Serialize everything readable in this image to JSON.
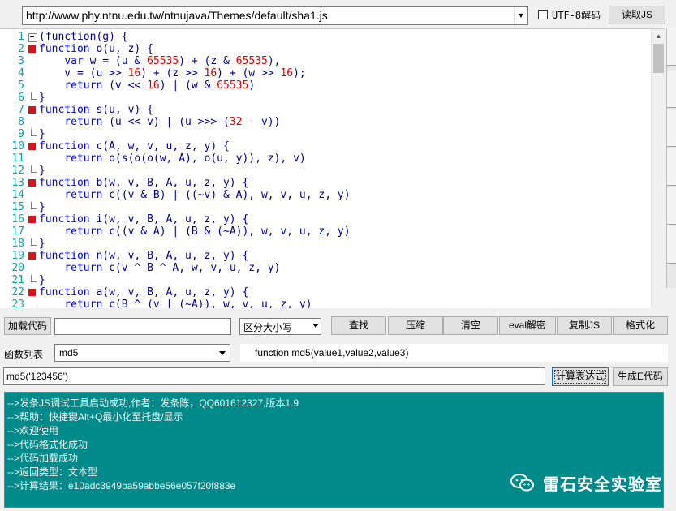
{
  "url_bar": {
    "value": "http://www.phy.ntnu.edu.tw/ntnujava/Themes/default/sha1.js",
    "utf8_label": "UTF-8解码",
    "utf8_checked": false,
    "read_js_label": "读取JS"
  },
  "editor": {
    "line_numbers": [
      "1",
      "2",
      "3",
      "4",
      "5",
      "6",
      "7",
      "8",
      "9",
      "10",
      "11",
      "12",
      "13",
      "14",
      "15",
      "16",
      "17",
      "18",
      "19",
      "20",
      "21",
      "22",
      "23"
    ]
  },
  "controls": {
    "load_code_label": "加载代码",
    "search_value": "",
    "case_mode": "区分大小写",
    "find_label": "查找",
    "compress_label": "压缩",
    "clear_label": "清空",
    "eval_label": "eval解密",
    "copy_label": "复制JS",
    "format_label": "格式化"
  },
  "function_list": {
    "label": "函数列表",
    "selected": "md5",
    "signature": "function md5(value1,value2,value3)"
  },
  "expression": {
    "value": "md5('123456')",
    "calc_label": "计算表达式",
    "gen_e_label": "生成E代码"
  },
  "log": [
    "-->发条JS调试工具启动成功,作者：发条陈，QQ601612327,版本1.9",
    "-->帮助：快捷键Alt+Q最小化至托盘/显示",
    "-->欢迎使用",
    "-->代码格式化成功",
    "-->代码加载成功",
    "-->返回类型：文本型",
    "-->计算结果：e10adc3949ba59abbe56e057f20f883e"
  ],
  "watermark": {
    "text": "雷石安全实验室",
    "icon": "wechat-icon"
  },
  "colors": {
    "log_bg": "#008a8a",
    "line_number": "#0f9fa6",
    "fold_marker": "#e0101a",
    "number_literal": "#e00000",
    "keyword": "#0000ff"
  }
}
